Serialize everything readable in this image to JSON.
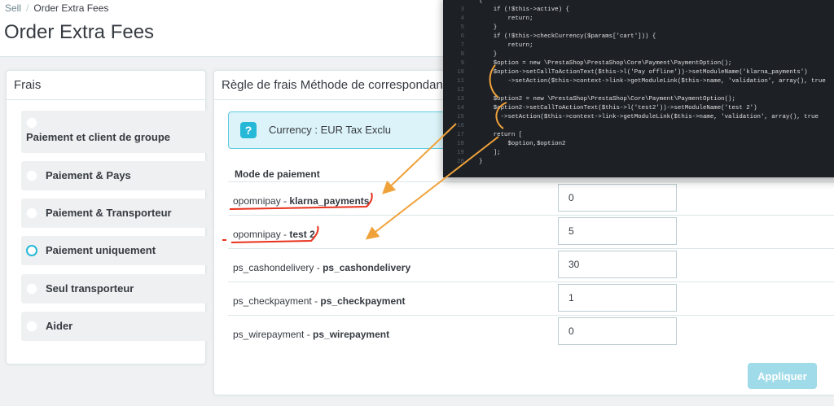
{
  "breadcrumb": {
    "root": "Sell",
    "separator": "/",
    "current": "Order Extra Fees"
  },
  "page_title": "Order Extra Fees",
  "left_panel": {
    "title": "Frais",
    "options": [
      {
        "label": "Paiement et client de groupe",
        "selected": false
      },
      {
        "label": "Paiement & Pays",
        "selected": false
      },
      {
        "label": "Paiement & Transporteur",
        "selected": false
      },
      {
        "label": "Paiement uniquement",
        "selected": true
      },
      {
        "label": "Seul transporteur",
        "selected": false
      },
      {
        "label": "Aider",
        "selected": false
      }
    ]
  },
  "right_panel": {
    "title": "Règle de frais Méthode de correspondance",
    "info_icon": "?",
    "info_text": "Currency : EUR Tax Exclu",
    "column_header": "Mode de paiement",
    "rows": [
      {
        "module": "opomnipay",
        "sep": " - ",
        "name": "klarna_payments",
        "value": "0"
      },
      {
        "module": "opomnipay",
        "sep": " - ",
        "name": "test 2",
        "value": "5"
      },
      {
        "module": "ps_cashondelivery",
        "sep": " - ",
        "name": "ps_cashondelivery",
        "value": "30"
      },
      {
        "module": "ps_checkpayment",
        "sep": " - ",
        "name": "ps_checkpayment",
        "value": "1"
      },
      {
        "module": "ps_wirepayment",
        "sep": " - ",
        "name": "ps_wirepayment",
        "value": "0"
      }
    ],
    "apply_label": "Appliquer"
  },
  "code": {
    "numbers": [
      "",
      "3",
      "4",
      "5",
      "6",
      "7",
      "8",
      "9",
      "10",
      "11",
      "12",
      "13",
      "14",
      "15",
      "16",
      "17",
      "18",
      "19",
      "20"
    ],
    "lines": [
      "{",
      "    if (!$this->active) {",
      "        return;",
      "    }",
      "    if (!$this->checkCurrency($params['cart'])) {",
      "        return;",
      "    }",
      "    $option = new \\PrestaShop\\PrestaShop\\Core\\Payment\\PaymentOption();",
      "    $option->setCallToActionText($this->l('Pay offline'))->setModuleName('klarna_payments')",
      "        ->setAction($this->context->link->getModuleLink($this->name, 'validation', array(), true",
      "",
      "    $option2 = new \\PrestaShop\\PrestaShop\\Core\\Payment\\PaymentOption();",
      "    $option2->setCallToActionText($this->l('test2'))->setModuleName('test 2')",
      "      ->setAction($this->context->link->getModuleLink($this->name, 'validation', array(), true",
      "",
      "    return [",
      "        $option,$option2",
      "    ];",
      "}"
    ]
  },
  "colors": {
    "accent": "#25b9d7",
    "annotation_arrow": "#f0a23a",
    "annotation_mark": "#e8311c",
    "code_bg": "#1d2126"
  }
}
